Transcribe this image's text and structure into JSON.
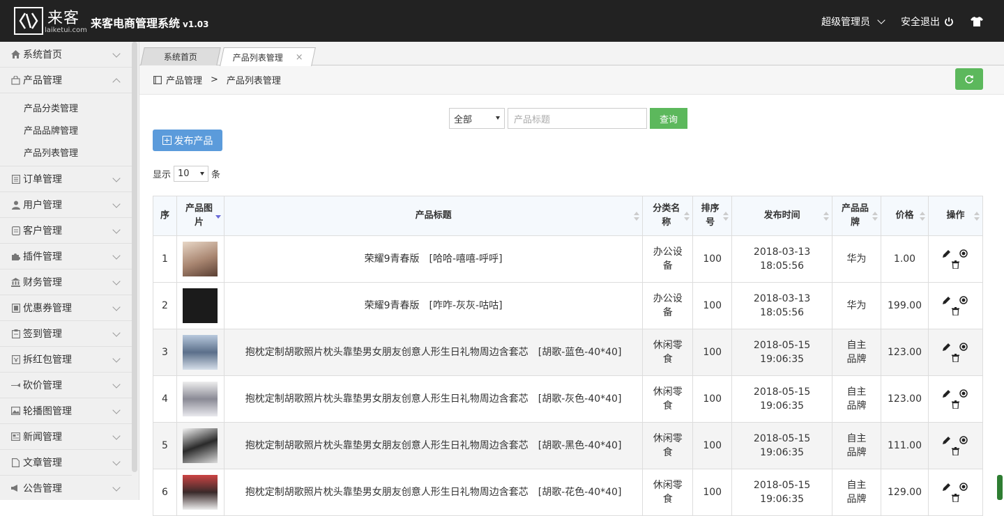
{
  "header": {
    "logo_cn": "来客",
    "logo_en": "laiketui.com",
    "app_title": "来客电商管理系统",
    "version": "v1.03",
    "user": "超级管理员",
    "logout": "安全退出"
  },
  "sidebar": {
    "items": [
      {
        "label": "系统首页",
        "icon": "home-icon"
      },
      {
        "label": "产品管理",
        "icon": "bag-icon",
        "expanded": true,
        "children": [
          "产品分类管理",
          "产品品牌管理",
          "产品列表管理"
        ]
      },
      {
        "label": "订单管理",
        "icon": "list-icon"
      },
      {
        "label": "用户管理",
        "icon": "user-icon"
      },
      {
        "label": "客户管理",
        "icon": "doc-icon"
      },
      {
        "label": "插件管理",
        "icon": "puzzle-icon"
      },
      {
        "label": "财务管理",
        "icon": "bank-icon"
      },
      {
        "label": "优惠券管理",
        "icon": "coupon-icon"
      },
      {
        "label": "签到管理",
        "icon": "clipboard-icon"
      },
      {
        "label": "拆红包管理",
        "icon": "envelope-icon"
      },
      {
        "label": "砍价管理",
        "icon": "knife-icon"
      },
      {
        "label": "轮播图管理",
        "icon": "image-icon"
      },
      {
        "label": "新闻管理",
        "icon": "news-icon"
      },
      {
        "label": "文章管理",
        "icon": "file-icon"
      },
      {
        "label": "公告管理",
        "icon": "megaphone-icon"
      }
    ]
  },
  "tabs": [
    {
      "label": "系统首页",
      "active": false
    },
    {
      "label": "产品列表管理",
      "active": true,
      "close": "×"
    }
  ],
  "breadcrumb": {
    "level1": "产品管理",
    "sep": ">",
    "level2": "产品列表管理"
  },
  "filter": {
    "select_value": "全部",
    "input_placeholder": "产品标题",
    "query_label": "查询"
  },
  "publish_label": "发布产品",
  "page_size": {
    "prefix": "显示",
    "value": "10",
    "suffix": "条"
  },
  "table": {
    "headers": [
      "序",
      "产品图片",
      "产品标题",
      "分类名称",
      "排序号",
      "发布时间",
      "产品品牌",
      "价格",
      "操作"
    ],
    "rows": [
      {
        "idx": "1",
        "title": "荣耀9青春版　[哈哈-嘻嘻-呼呼]",
        "category": "办公设备",
        "sort": "100",
        "date": "2018-03-13",
        "time": "18:05:56",
        "brand": "华为",
        "price": "1.00"
      },
      {
        "idx": "2",
        "title": "荣耀9青春版　[咋咋-灰灰-咕咕]",
        "category": "办公设备",
        "sort": "100",
        "date": "2018-03-13",
        "time": "18:05:56",
        "brand": "华为",
        "price": "199.00"
      },
      {
        "idx": "3",
        "title": "抱枕定制胡歌照片枕头靠垫男女朋友创意人形生日礼物周边含套芯　[胡歌-蓝色-40*40]",
        "category": "休闲零食",
        "sort": "100",
        "date": "2018-05-15",
        "time": "19:06:35",
        "brand": "自主品牌",
        "price": "123.00"
      },
      {
        "idx": "4",
        "title": "抱枕定制胡歌照片枕头靠垫男女朋友创意人形生日礼物周边含套芯　[胡歌-灰色-40*40]",
        "category": "休闲零食",
        "sort": "100",
        "date": "2018-05-15",
        "time": "19:06:35",
        "brand": "自主品牌",
        "price": "123.00"
      },
      {
        "idx": "5",
        "title": "抱枕定制胡歌照片枕头靠垫男女朋友创意人形生日礼物周边含套芯　[胡歌-黑色-40*40]",
        "category": "休闲零食",
        "sort": "100",
        "date": "2018-05-15",
        "time": "19:06:35",
        "brand": "自主品牌",
        "price": "111.00"
      },
      {
        "idx": "6",
        "title": "抱枕定制胡歌照片枕头靠垫男女朋友创意人形生日礼物周边含套芯　[胡歌-花色-40*40]",
        "category": "休闲零食",
        "sort": "100",
        "date": "2018-05-15",
        "time": "19:06:35",
        "brand": "自主品牌",
        "price": "129.00"
      }
    ]
  },
  "colors": {
    "topbar": "#222222",
    "primary_green": "#5cb85c",
    "primary_blue": "#5b9bdb",
    "price_red": "#d9000e"
  }
}
